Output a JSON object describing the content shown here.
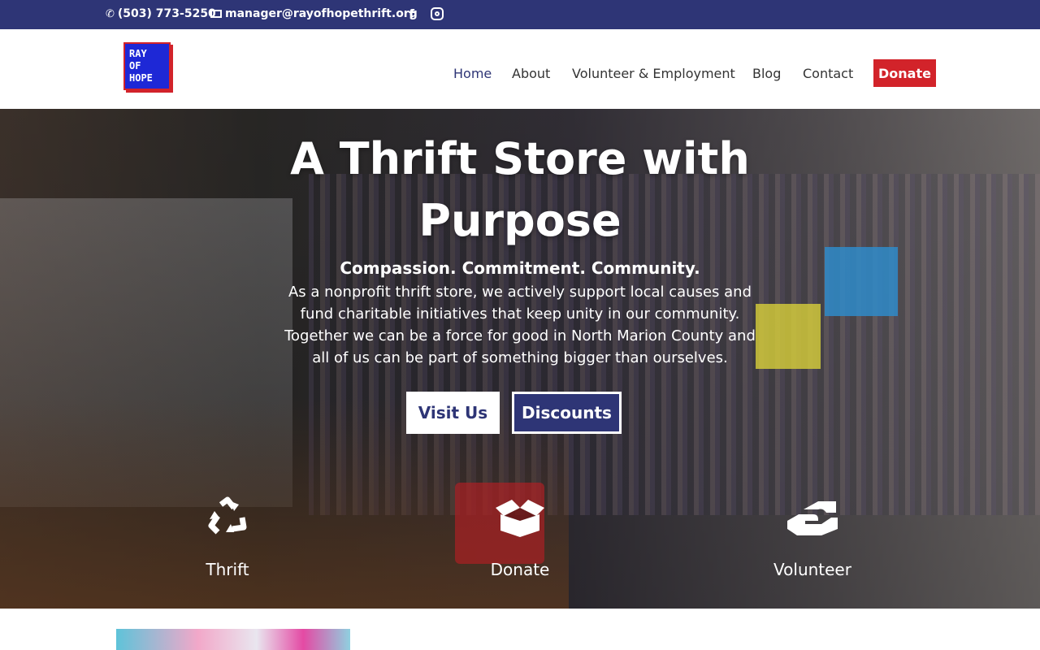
{
  "topbar": {
    "phone": "(503) 773-5250",
    "email": "manager@rayofhopethrift.org",
    "social": [
      "facebook-icon",
      "instagram-icon"
    ]
  },
  "header": {
    "logo_lines": [
      "RAY",
      "OF",
      "HOPE"
    ],
    "nav": {
      "home": "Home",
      "about": "About",
      "volunteer": "Volunteer & Employment",
      "blog": "Blog",
      "contact": "Contact",
      "donate": "Donate"
    }
  },
  "hero": {
    "title": "A Thrift Store with Purpose",
    "tagline": "Compassion. Commitment. Community.",
    "body": "As a nonprofit thrift store, we actively support local causes and fund charitable initiatives that keep unity in our community. Together we can be a force for good in North Marion County and all of us can be part of something bigger than ourselves.",
    "btn_visit": "Visit Us",
    "btn_discounts": "Discounts"
  },
  "features": {
    "thrift": {
      "label": "Thrift",
      "icon": "recycle-icon"
    },
    "donate": {
      "label": "Donate",
      "icon": "open-box-icon"
    },
    "volunteer": {
      "label": "Volunteer",
      "icon": "handshake-icon"
    }
  },
  "colors": {
    "brand_navy": "#2e3576",
    "brand_red": "#d2232a",
    "logo_blue": "#1e28d6"
  }
}
